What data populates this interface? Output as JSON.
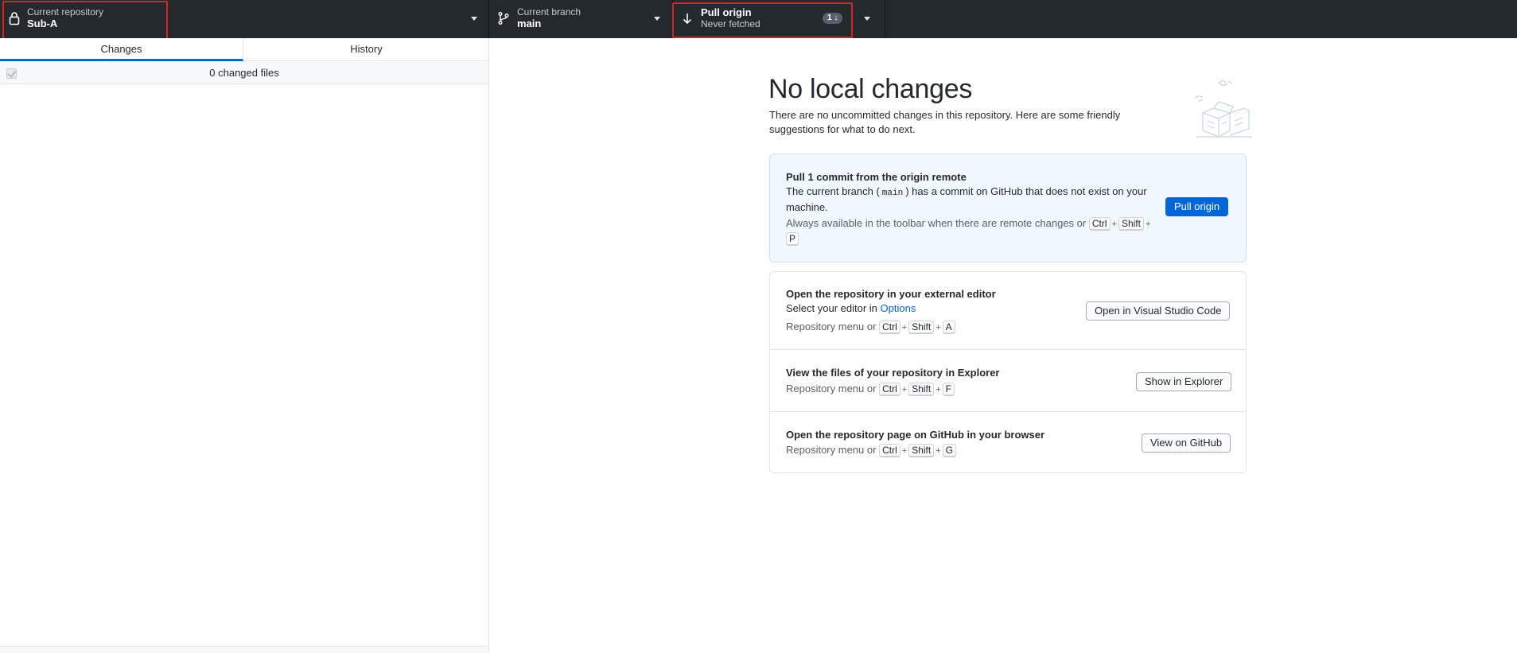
{
  "toolbar": {
    "repository": {
      "title": "Current repository",
      "name": "Sub-A",
      "icon": "lock-icon"
    },
    "branch": {
      "title": "Current branch",
      "name": "main",
      "icon": "git-branch-icon"
    },
    "pull": {
      "title": "Pull origin",
      "subtitle": "Never fetched",
      "icon": "arrow-down-icon",
      "badge": "1 ↓"
    }
  },
  "sidebar": {
    "tabs": [
      "Changes",
      "History"
    ],
    "active_tab": "Changes",
    "changed_files": "0 changed files"
  },
  "main": {
    "title": "No local changes",
    "description": "There are no uncommitted changes in this repository. Here are some friendly suggestions for what to do next.",
    "pull_card": {
      "title": "Pull 1 commit from the origin remote",
      "desc_before": "The current branch (",
      "branch": "main",
      "desc_after": ") has a commit on GitHub that does not exist on your machine.",
      "shortcut_text": "Always available in the toolbar when there are remote changes or",
      "keys": [
        "Ctrl",
        "Shift",
        "P"
      ],
      "button": "Pull origin"
    },
    "editor_row": {
      "title": "Open the repository in your external editor",
      "desc": "Select your editor in",
      "link": "Options",
      "shortcut_text": "Repository menu or",
      "keys": [
        "Ctrl",
        "Shift",
        "A"
      ],
      "button": "Open in Visual Studio Code"
    },
    "explorer_row": {
      "title": "View the files of your repository in Explorer",
      "shortcut_text": "Repository menu or",
      "keys": [
        "Ctrl",
        "Shift",
        "F"
      ],
      "button": "Show in Explorer"
    },
    "github_row": {
      "title": "Open the repository page on GitHub in your browser",
      "shortcut_text": "Repository menu or",
      "keys": [
        "Ctrl",
        "Shift",
        "G"
      ],
      "button": "View on GitHub"
    }
  },
  "colors": {
    "toolbar_bg": "#24292e",
    "accent": "#0366d6",
    "highlight": "#e0201b",
    "pull_card_bg": "#f1f8ff"
  }
}
